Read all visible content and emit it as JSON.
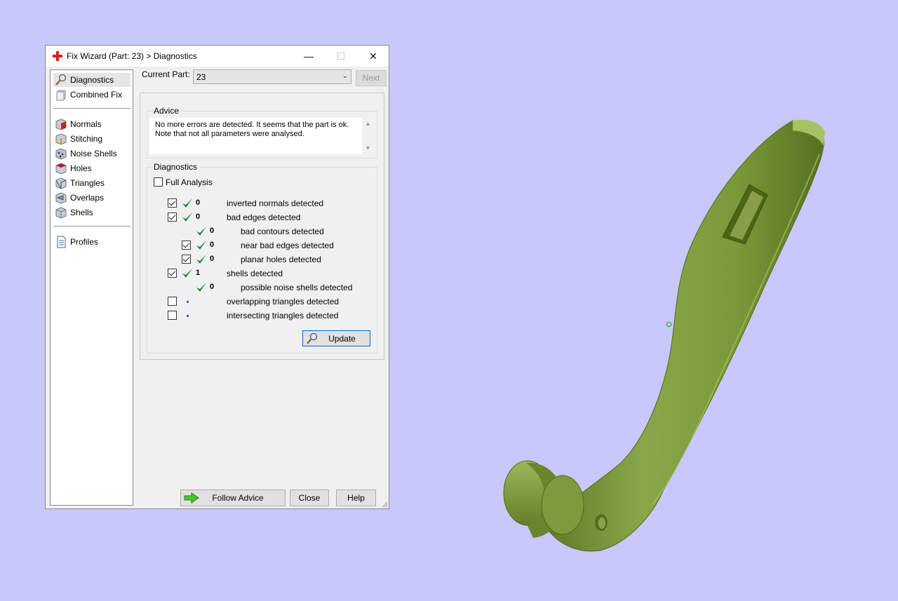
{
  "window": {
    "title": "Fix Wizard (Part: 23) > Diagnostics",
    "controls": {
      "minimize": "—",
      "maximize": "☐",
      "close": "✕"
    }
  },
  "nav": {
    "items": [
      {
        "label": "Diagnostics",
        "icon": "magnifier-icon"
      },
      {
        "label": "Combined Fix",
        "icon": "combined-fix-icon"
      },
      {
        "label": "Normals",
        "icon": "normals-cube-icon"
      },
      {
        "label": "Stitching",
        "icon": "stitching-cube-icon"
      },
      {
        "label": "Noise Shells",
        "icon": "noise-shells-icon"
      },
      {
        "label": "Holes",
        "icon": "holes-cube-icon"
      },
      {
        "label": "Triangles",
        "icon": "triangles-cube-icon"
      },
      {
        "label": "Overlaps",
        "icon": "overlaps-cube-icon"
      },
      {
        "label": "Shells",
        "icon": "shells-cube-icon"
      },
      {
        "label": "Profiles",
        "icon": "document-icon"
      }
    ],
    "selected": "Diagnostics"
  },
  "header": {
    "current_part_label": "Current Part:",
    "current_part_value": "23",
    "next_label": "Next"
  },
  "advice": {
    "title": "Advice",
    "text": "No more errors are detected. It seems that the part is ok. Note that not all parameters were analysed."
  },
  "diagnostics": {
    "title": "Diagnostics",
    "full_analysis_label": "Full Analysis",
    "full_analysis_checked": false,
    "rows": [
      {
        "checkbox": true,
        "checked": true,
        "status": "ok",
        "count": "0",
        "label": "inverted normals detected",
        "indent": 0
      },
      {
        "checkbox": true,
        "checked": true,
        "status": "ok",
        "count": "0",
        "label": "bad edges detected",
        "indent": 0
      },
      {
        "checkbox": false,
        "checked": false,
        "status": "ok",
        "count": "0",
        "label": "bad contours detected",
        "indent": 1
      },
      {
        "checkbox": true,
        "checked": true,
        "status": "ok",
        "count": "0",
        "label": "near bad edges detected",
        "indent": 1
      },
      {
        "checkbox": true,
        "checked": true,
        "status": "ok",
        "count": "0",
        "label": "planar holes detected",
        "indent": 1
      },
      {
        "checkbox": true,
        "checked": true,
        "status": "ok",
        "count": "1",
        "label": "shells detected",
        "indent": 0
      },
      {
        "checkbox": false,
        "checked": false,
        "status": "ok",
        "count": "0",
        "label": "possible noise shells detected",
        "indent": 1
      },
      {
        "checkbox": true,
        "checked": false,
        "status": "none",
        "count": "",
        "label": "overlapping triangles detected",
        "indent": 0
      },
      {
        "checkbox": true,
        "checked": false,
        "status": "none",
        "count": "",
        "label": "intersecting triangles detected",
        "indent": 0
      }
    ],
    "update_label": "Update"
  },
  "buttons": {
    "follow_advice": "Follow Advice",
    "close": "Close",
    "help": "Help"
  },
  "colors": {
    "background": "#c8c8fa",
    "model": "#7f9c3e",
    "check_green": "#1e8a3a",
    "accent_border": "#0a64d0"
  }
}
